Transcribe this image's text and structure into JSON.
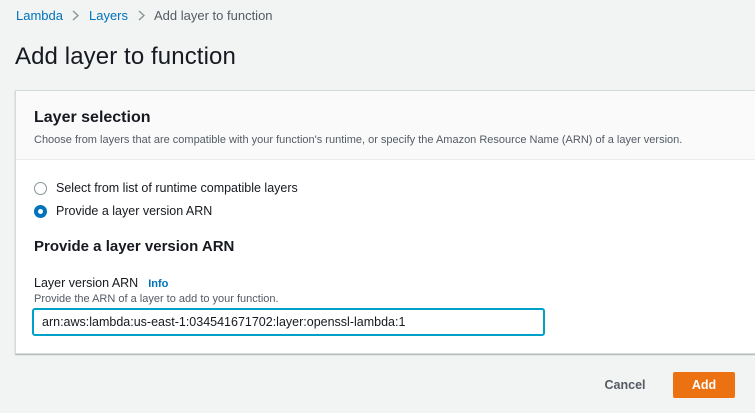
{
  "breadcrumb": {
    "items": [
      "Lambda",
      "Layers"
    ],
    "current": "Add layer to function"
  },
  "page": {
    "title": "Add layer to function"
  },
  "layer_selection": {
    "title": "Layer selection",
    "description": "Choose from layers that are compatible with your function's runtime, or specify the Amazon Resource Name (ARN) of a layer version.",
    "options": [
      {
        "label": "Select from list of runtime compatible layers",
        "checked": false
      },
      {
        "label": "Provide a layer version ARN",
        "checked": true
      }
    ]
  },
  "arn_section": {
    "title": "Provide a layer version ARN",
    "field_label": "Layer version ARN",
    "info_label": "Info",
    "field_description": "Provide the ARN of a layer to add to your function.",
    "value": "arn:aws:lambda:us-east-1:034541671702:layer:openssl-lambda:1"
  },
  "actions": {
    "cancel_label": "Cancel",
    "add_label": "Add"
  },
  "colors": {
    "link": "#0073bb",
    "primary_button": "#ec7211",
    "focus_border": "#00a1c9",
    "page_background": "#f2f3f3"
  },
  "icons": {
    "breadcrumb_separator": "chevron-right-icon"
  }
}
